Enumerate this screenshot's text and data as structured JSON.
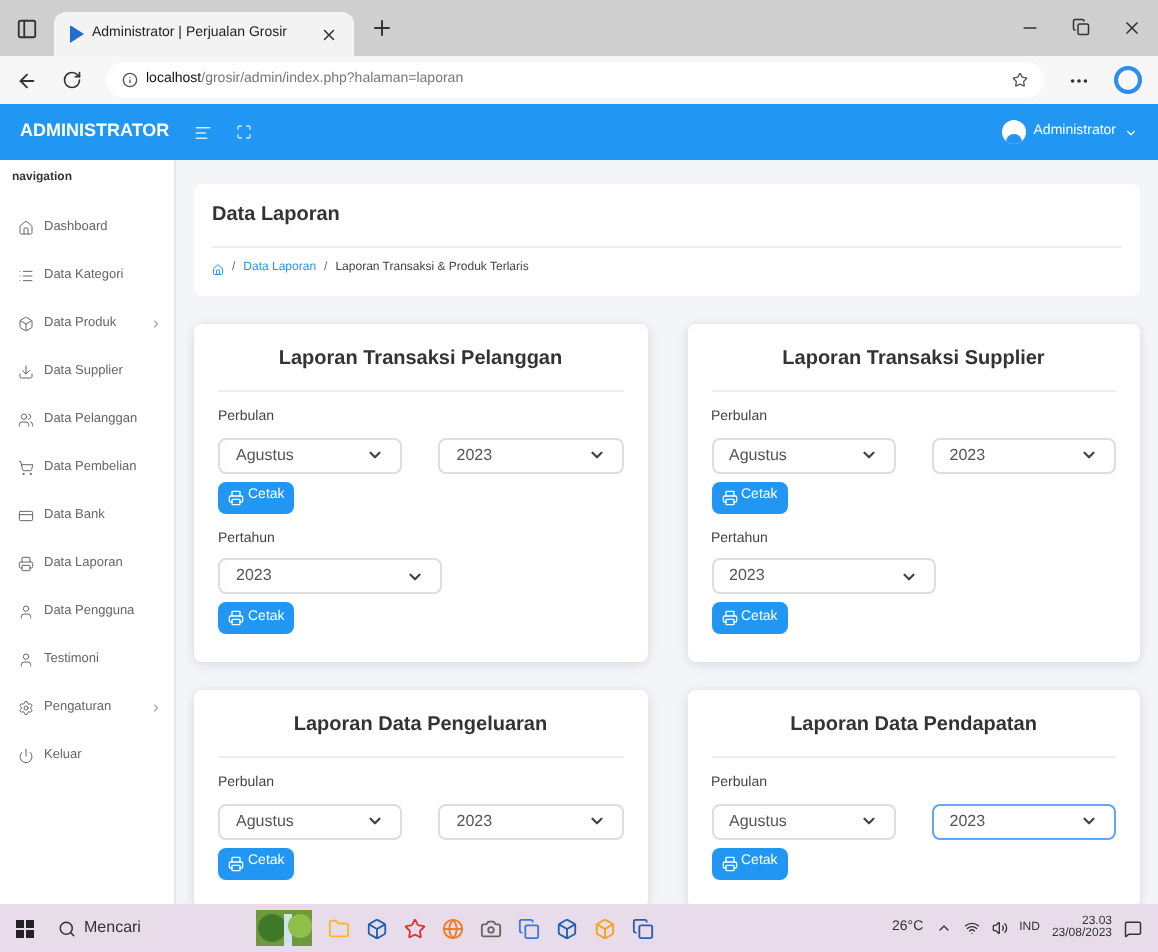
{
  "browser": {
    "tab_title": "Administrator | Perjualan Grosir",
    "url_host": "localhost",
    "url_path": "/grosir/admin/index.php?halaman=laporan"
  },
  "header": {
    "brand": "ADMINISTRATOR",
    "user": "Administrator"
  },
  "sidebar": {
    "heading": "navigation",
    "items": [
      {
        "label": "Dashboard",
        "submenu": false
      },
      {
        "label": "Data Kategori",
        "submenu": false
      },
      {
        "label": "Data Produk",
        "submenu": true
      },
      {
        "label": "Data Supplier",
        "submenu": false
      },
      {
        "label": "Data Pelanggan",
        "submenu": false
      },
      {
        "label": "Data Pembelian",
        "submenu": false
      },
      {
        "label": "Data Bank",
        "submenu": false
      },
      {
        "label": "Data Laporan",
        "submenu": false
      },
      {
        "label": "Data Pengguna",
        "submenu": false
      },
      {
        "label": "Testimoni",
        "submenu": false
      },
      {
        "label": "Pengaturan",
        "submenu": true
      },
      {
        "label": "Keluar",
        "submenu": false
      }
    ]
  },
  "page": {
    "title": "Data Laporan",
    "breadcrumb": [
      {
        "separator": "/",
        "label": "Data Laporan"
      },
      {
        "separator": "/",
        "label": "Laporan Transaksi & Produk Terlaris"
      }
    ]
  },
  "reports": [
    {
      "title": "Laporan Transaksi Pelanggan",
      "sections": [
        {
          "label": "Perbulan",
          "selects": [
            {
              "value": "Agustus",
              "focused": false
            },
            {
              "value": "2023",
              "focused": false
            }
          ],
          "button": "Cetak"
        },
        {
          "label": "Pertahun",
          "selects": [
            {
              "value": "2023",
              "focused": false
            }
          ],
          "button": "Cetak"
        }
      ]
    },
    {
      "title": "Laporan Transaksi Supplier",
      "sections": [
        {
          "label": "Perbulan",
          "selects": [
            {
              "value": "Agustus",
              "focused": false
            },
            {
              "value": "2023",
              "focused": false
            }
          ],
          "button": "Cetak"
        },
        {
          "label": "Pertahun",
          "selects": [
            {
              "value": "2023",
              "focused": false
            }
          ],
          "button": "Cetak"
        }
      ]
    },
    {
      "title": "Laporan Data Pengeluaran",
      "sections": [
        {
          "label": "Perbulan",
          "selects": [
            {
              "value": "Agustus",
              "focused": false
            },
            {
              "value": "2023",
              "focused": false
            }
          ],
          "button": "Cetak"
        }
      ]
    },
    {
      "title": "Laporan Data Pendapatan",
      "sections": [
        {
          "label": "Perbulan",
          "selects": [
            {
              "value": "Agustus",
              "focused": false
            },
            {
              "value": "2023",
              "focused": true
            }
          ],
          "button": "Cetak"
        }
      ]
    }
  ],
  "taskbar": {
    "search": "Mencari",
    "weather": "26°C",
    "language": "IND",
    "time": "23.03",
    "date": "23/08/2023"
  }
}
